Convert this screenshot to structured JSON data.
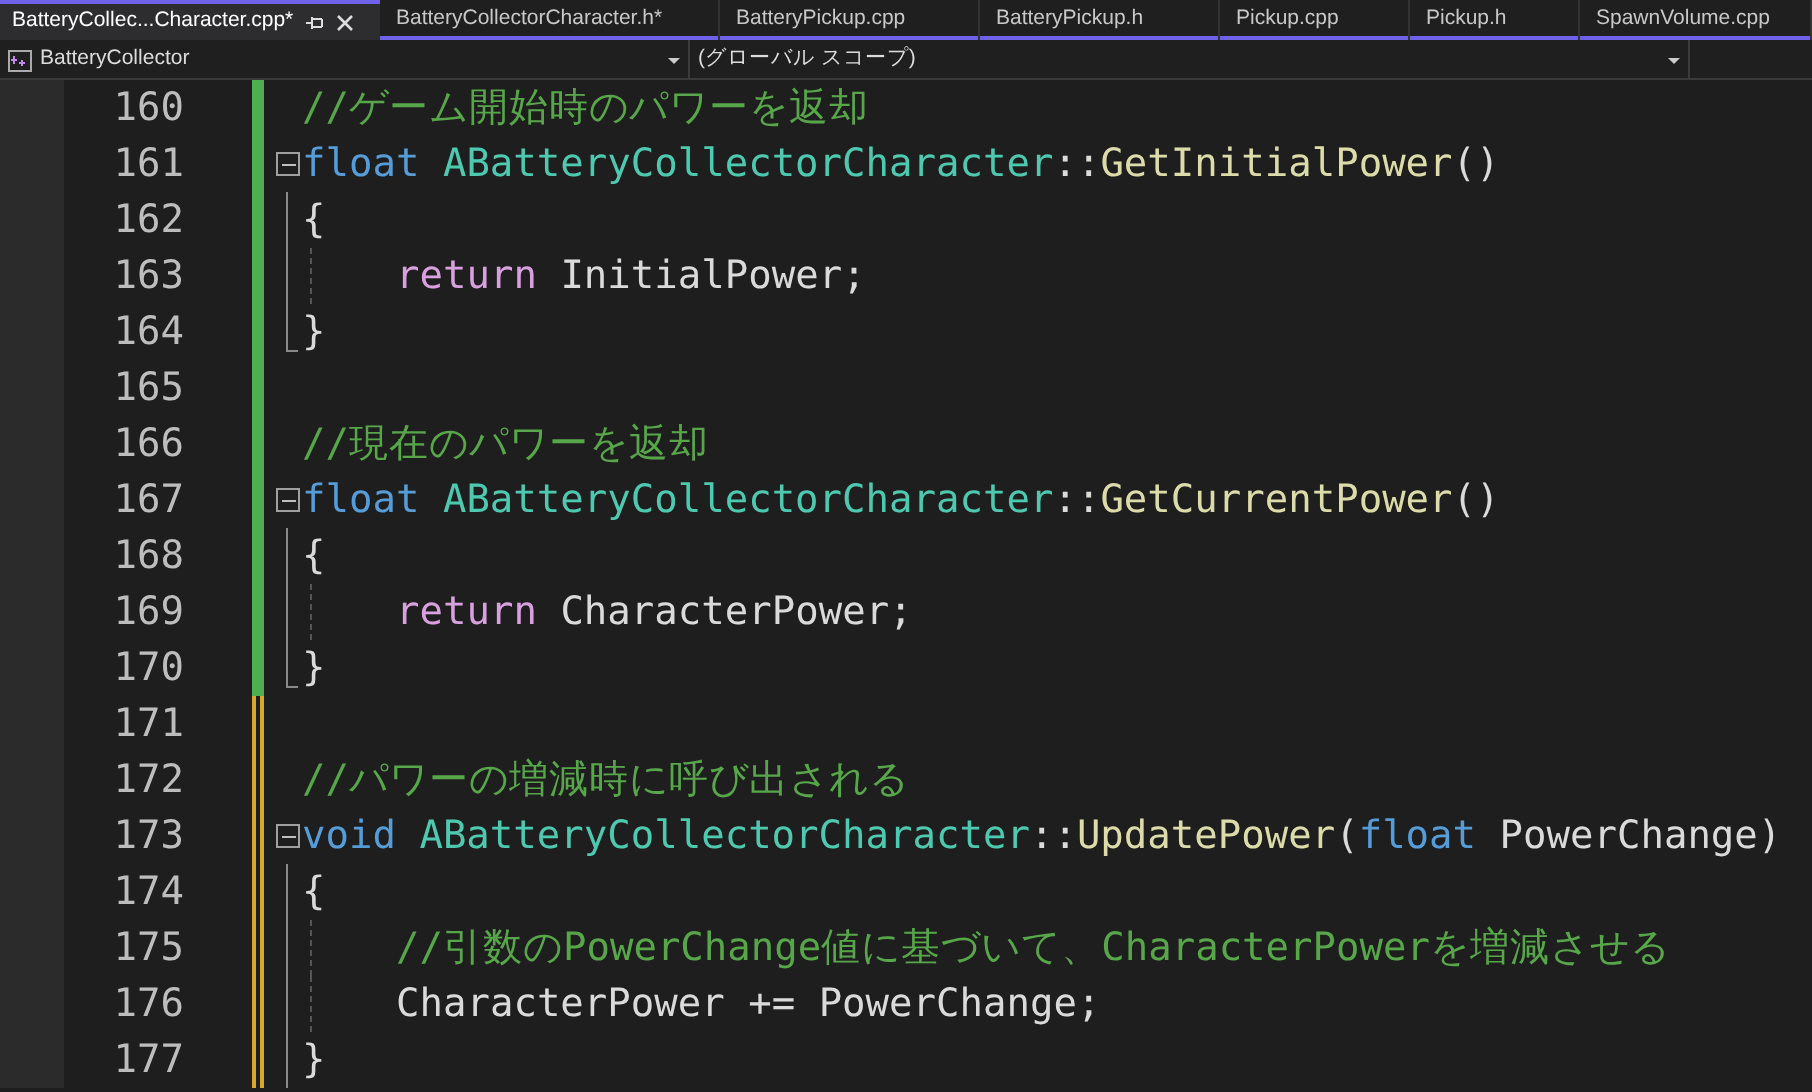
{
  "tabs": [
    {
      "label": "BatteryCollec...Character.cpp*",
      "selected": true,
      "pinnable": true,
      "closable": true
    },
    {
      "label": "BatteryCollectorCharacter.h*",
      "selected": false,
      "pinnable": false,
      "closable": false
    },
    {
      "label": "BatteryPickup.cpp",
      "selected": false,
      "pinnable": false,
      "closable": false
    },
    {
      "label": "BatteryPickup.h",
      "selected": false,
      "pinnable": false,
      "closable": false
    },
    {
      "label": "Pickup.cpp",
      "selected": false,
      "pinnable": false,
      "closable": false
    },
    {
      "label": "Pickup.h",
      "selected": false,
      "pinnable": false,
      "closable": false
    },
    {
      "label": "SpawnVolume.cpp",
      "selected": false,
      "pinnable": false,
      "closable": false
    }
  ],
  "navigation_bar": {
    "project": "BatteryCollector",
    "scope": "(グローバル スコープ)"
  },
  "editor": {
    "lines": [
      {
        "number": "160",
        "saved": true,
        "collapsible": false,
        "in_block": false,
        "block_end": false,
        "indented": false,
        "tokens": [
          {
            "kind": "comment",
            "text": "//ゲーム開始時のパワーを返却"
          }
        ]
      },
      {
        "number": "161",
        "saved": true,
        "collapsible": true,
        "in_block": false,
        "block_end": false,
        "indented": false,
        "tokens": [
          {
            "kind": "keyword",
            "text": "float "
          },
          {
            "kind": "type",
            "text": "ABatteryCollectorCharacter"
          },
          {
            "kind": "plain",
            "text": "::"
          },
          {
            "kind": "function",
            "text": "GetInitialPower"
          },
          {
            "kind": "plain",
            "text": "()"
          }
        ]
      },
      {
        "number": "162",
        "saved": true,
        "collapsible": false,
        "in_block": true,
        "block_end": false,
        "indented": false,
        "tokens": [
          {
            "kind": "plain",
            "text": "{"
          }
        ]
      },
      {
        "number": "163",
        "saved": true,
        "collapsible": false,
        "in_block": true,
        "block_end": false,
        "indented": true,
        "tokens": [
          {
            "kind": "control",
            "text": "return"
          },
          {
            "kind": "plain",
            "text": " InitialPower;"
          }
        ]
      },
      {
        "number": "164",
        "saved": true,
        "collapsible": false,
        "in_block": true,
        "block_end": true,
        "indented": false,
        "tokens": [
          {
            "kind": "plain",
            "text": "}"
          }
        ]
      },
      {
        "number": "165",
        "saved": true,
        "collapsible": false,
        "in_block": false,
        "block_end": false,
        "indented": false
      },
      {
        "number": "166",
        "saved": true,
        "collapsible": false,
        "in_block": false,
        "block_end": false,
        "indented": false,
        "tokens": [
          {
            "kind": "comment",
            "text": "//現在のパワーを返却"
          }
        ]
      },
      {
        "number": "167",
        "saved": true,
        "collapsible": true,
        "in_block": false,
        "block_end": false,
        "indented": false,
        "tokens": [
          {
            "kind": "keyword",
            "text": "float "
          },
          {
            "kind": "type",
            "text": "ABatteryCollectorCharacter"
          },
          {
            "kind": "plain",
            "text": "::"
          },
          {
            "kind": "function",
            "text": "GetCurrentPower"
          },
          {
            "kind": "plain",
            "text": "()"
          }
        ]
      },
      {
        "number": "168",
        "saved": true,
        "collapsible": false,
        "in_block": true,
        "block_end": false,
        "indented": false,
        "tokens": [
          {
            "kind": "plain",
            "text": "{"
          }
        ]
      },
      {
        "number": "169",
        "saved": true,
        "collapsible": false,
        "in_block": true,
        "block_end": false,
        "indented": true,
        "tokens": [
          {
            "kind": "control",
            "text": "return"
          },
          {
            "kind": "plain",
            "text": " CharacterPower;"
          }
        ]
      },
      {
        "number": "170",
        "saved": true,
        "collapsible": false,
        "in_block": true,
        "block_end": true,
        "indented": false,
        "tokens": [
          {
            "kind": "plain",
            "text": "}"
          }
        ]
      },
      {
        "number": "171",
        "saved": false,
        "collapsible": false,
        "in_block": false,
        "block_end": false,
        "indented": false
      },
      {
        "number": "172",
        "saved": false,
        "collapsible": false,
        "in_block": false,
        "block_end": false,
        "indented": false,
        "tokens": [
          {
            "kind": "comment",
            "text": "//パワーの増減時に呼び出される"
          }
        ]
      },
      {
        "number": "173",
        "saved": false,
        "collapsible": true,
        "in_block": false,
        "block_end": false,
        "indented": false,
        "tokens": [
          {
            "kind": "keyword",
            "text": "void "
          },
          {
            "kind": "type",
            "text": "ABatteryCollectorCharacter"
          },
          {
            "kind": "plain",
            "text": "::"
          },
          {
            "kind": "function",
            "text": "UpdatePower"
          },
          {
            "kind": "plain",
            "text": "("
          },
          {
            "kind": "keyword",
            "text": "float"
          },
          {
            "kind": "plain",
            "text": " PowerChange)"
          }
        ]
      },
      {
        "number": "174",
        "saved": false,
        "collapsible": false,
        "in_block": true,
        "block_end": false,
        "indented": false,
        "tokens": [
          {
            "kind": "plain",
            "text": "{"
          }
        ]
      },
      {
        "number": "175",
        "saved": false,
        "collapsible": false,
        "in_block": true,
        "block_end": false,
        "indented": true,
        "tokens": [
          {
            "kind": "comment",
            "text": "//引数のPowerChange値に基づいて、CharacterPowerを増減させる"
          }
        ]
      },
      {
        "number": "176",
        "saved": false,
        "collapsible": false,
        "in_block": true,
        "block_end": false,
        "indented": true,
        "tokens": [
          {
            "kind": "plain",
            "text": "CharacterPower += PowerChange;"
          }
        ]
      },
      {
        "number": "177",
        "saved": false,
        "collapsible": false,
        "in_block": true,
        "block_end": false,
        "indented": false,
        "tokens": [
          {
            "kind": "plain",
            "text": "}"
          }
        ]
      }
    ]
  }
}
